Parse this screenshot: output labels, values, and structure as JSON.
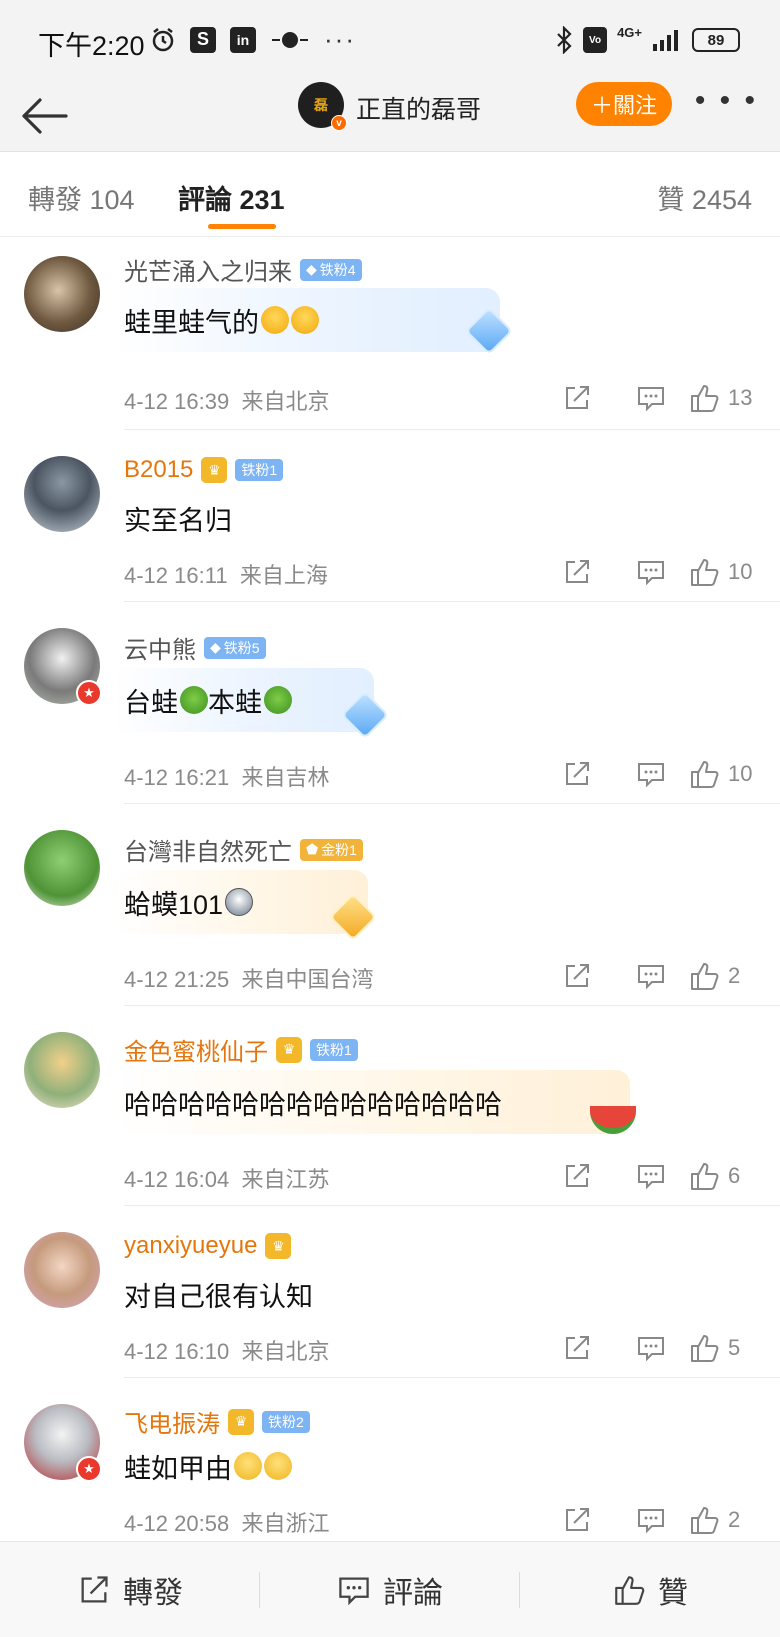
{
  "status_bar": {
    "time": "下午2:20",
    "icons": [
      "alarm-icon",
      "s-app-icon",
      "linkedin-icon",
      "media-icon",
      "more-dots"
    ],
    "network": "4G+",
    "battery": "89"
  },
  "nav": {
    "author_name": "正直的磊哥",
    "avatar_text": "磊",
    "follow_label": "＋關注",
    "more": "• • •"
  },
  "tabs": {
    "repost": "轉發 104",
    "comment": "評論 231",
    "like": "贊 2454"
  },
  "comments": [
    {
      "user": "光芒涌入之归来",
      "badge": "铁粉4",
      "text": "蛙里蛙气的",
      "time": "4-12 16:39",
      "location": "来自北京",
      "likes": "13"
    },
    {
      "user": "B2015",
      "badge": "铁粉1",
      "text": "实至名归",
      "time": "4-12 16:11",
      "location": "来自上海",
      "likes": "10"
    },
    {
      "user": "云中熊",
      "badge": "铁粉5",
      "text_a": "台蛙",
      "text_b": "本蛙",
      "time": "4-12 16:21",
      "location": "来自吉林",
      "likes": "10"
    },
    {
      "user": "台灣非自然死亡",
      "badge": "金粉1",
      "text": "蛤蟆101",
      "time": "4-12 21:25",
      "location": "来自中国台湾",
      "likes": "2"
    },
    {
      "user": "金色蜜桃仙子",
      "badge": "铁粉1",
      "text": "哈哈哈哈哈哈哈哈哈哈哈哈哈哈",
      "time": "4-12 16:04",
      "location": "来自江苏",
      "likes": "6"
    },
    {
      "user": "yanxiyueyue",
      "text": "对自己很有认知",
      "time": "4-12 16:10",
      "location": "来自北京",
      "likes": "5"
    },
    {
      "user": "飞电振涛",
      "badge": "铁粉2",
      "text": "蛙如甲由",
      "time": "4-12 20:58",
      "location": "来自浙江",
      "likes": "2"
    }
  ],
  "bottom_bar": {
    "repost": "轉發",
    "comment": "評論",
    "like": "贊"
  },
  "colors": {
    "accent": "#ff8200",
    "username_orange": "#e5760c",
    "badge_blue": "#7db4f3",
    "badge_gold": "#f2b33b"
  }
}
